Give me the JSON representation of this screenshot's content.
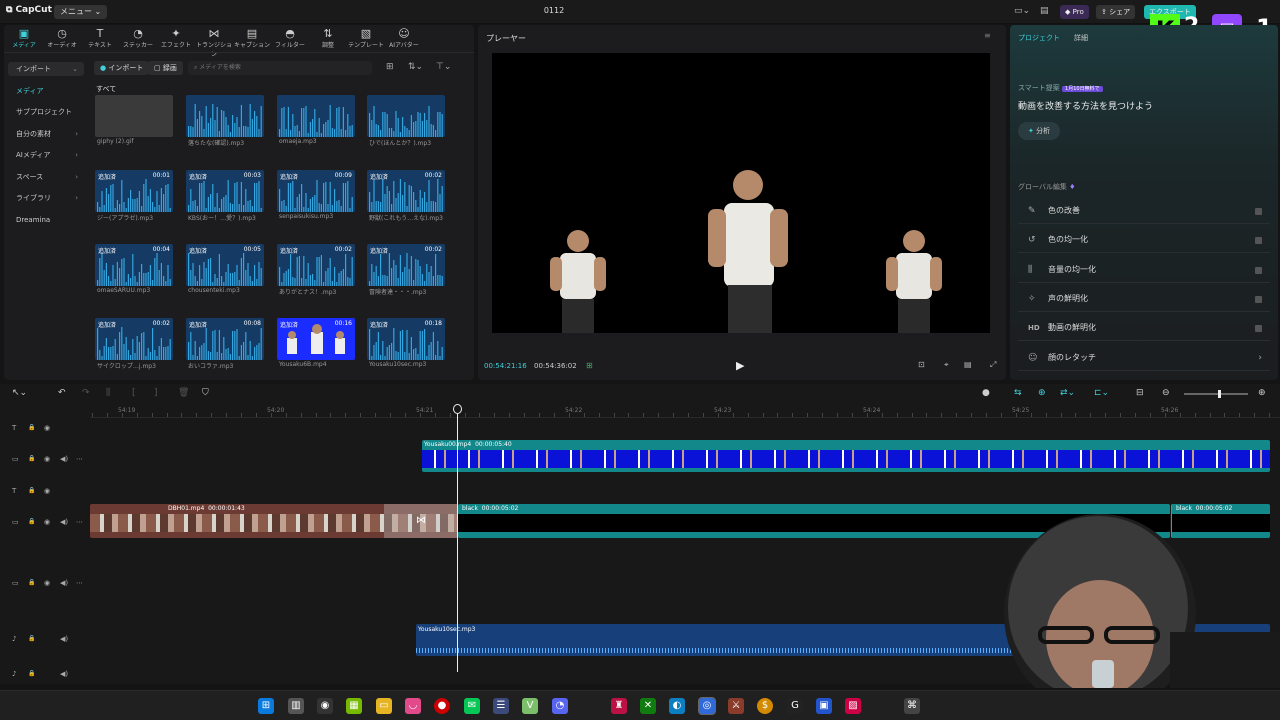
{
  "titlebar": {
    "app_name": "CapCut",
    "menu_label": "メニュー",
    "title": "0112",
    "pro_label": "Pro",
    "share_label": "シェア",
    "export_label": "エクスポート",
    "overlay_score": "2",
    "overlay_right": "1"
  },
  "media_tabs": [
    {
      "label": "メディア",
      "icon": "media-icon"
    },
    {
      "label": "オーディオ",
      "icon": "audio-icon"
    },
    {
      "label": "テキスト",
      "icon": "text-icon"
    },
    {
      "label": "ステッカー",
      "icon": "sticker-icon"
    },
    {
      "label": "エフェクト",
      "icon": "effect-icon"
    },
    {
      "label": "トランジション",
      "icon": "transition-icon"
    },
    {
      "label": "キャプション",
      "icon": "caption-icon"
    },
    {
      "label": "フィルター",
      "icon": "filter-icon"
    },
    {
      "label": "調整",
      "icon": "adjust-icon"
    },
    {
      "label": "テンプレート",
      "icon": "template-icon"
    },
    {
      "label": "AIアバター",
      "icon": "avatar-icon"
    }
  ],
  "sidebar": [
    {
      "label": "インポート",
      "chev": "⌄"
    },
    {
      "label": "メディア",
      "chev": ""
    },
    {
      "label": "サブプロジェクト",
      "chev": ""
    },
    {
      "label": "自分の素材",
      "chev": "›"
    },
    {
      "label": "AIメディア",
      "chev": "›"
    },
    {
      "label": "スペース",
      "chev": "›"
    },
    {
      "label": "ライブラリ",
      "chev": "›"
    },
    {
      "label": "Dreamina",
      "chev": ""
    }
  ],
  "media_toolbar": {
    "import_label": "インポート",
    "record_label": "録画",
    "search_placeholder": "メディアを検索",
    "all_label": "すべて"
  },
  "media_items": [
    {
      "name": "giphy (2).gif",
      "tag": "",
      "dur": ""
    },
    {
      "name": "落ちたな(確認).mp3",
      "tag": "",
      "dur": ""
    },
    {
      "name": "omaeja.mp3",
      "tag": "",
      "dur": ""
    },
    {
      "name": "ひで(ほんとか？).mp3",
      "tag": "",
      "dur": ""
    },
    {
      "name": "ジー(アプラゼ).mp3",
      "tag": "追加済",
      "dur": "00:01"
    },
    {
      "name": "KBS(おー！…愛？).mp3",
      "tag": "追加済",
      "dur": "00:03"
    },
    {
      "name": "senpaisukisu.mp3",
      "tag": "追加済",
      "dur": "00:09"
    },
    {
      "name": "野獣(これもう…えな).mp3",
      "tag": "追加済",
      "dur": "00:02"
    },
    {
      "name": "omaeSARUU.mp3",
      "tag": "追加済",
      "dur": "00:04"
    },
    {
      "name": "chousenteki.mp3",
      "tag": "追加済",
      "dur": "00:05"
    },
    {
      "name": "ありがとナス！.mp3",
      "tag": "追加済",
      "dur": "00:02"
    },
    {
      "name": "冒険者達・・・.mp3",
      "tag": "追加済",
      "dur": "00:02"
    },
    {
      "name": "サイクロップ…j.mp3",
      "tag": "追加済",
      "dur": "00:02"
    },
    {
      "name": "おいコラァ.mp3",
      "tag": "追加済",
      "dur": "00:08"
    },
    {
      "name": "Yousaku6B.mp4",
      "tag": "追加済",
      "dur": "00:16"
    },
    {
      "name": "Yousaku10sec.mp3",
      "tag": "追加済",
      "dur": "00:18"
    }
  ],
  "player": {
    "title": "プレーヤー",
    "current_time": "00:54:21:16",
    "total_time": "00:54:36:02"
  },
  "props": {
    "tab_project": "プロジェクト",
    "tab_detail": "詳細",
    "smart_title": "スマート提案",
    "smart_badge": "1月10日無料で",
    "smart_heading": "動画を改善する方法を見つけよう",
    "analyze_label": "分析",
    "global_title": "グローバル編集",
    "items": [
      {
        "label": "色の改善",
        "icon": "color-wand-icon"
      },
      {
        "label": "色の均一化",
        "icon": "color-match-icon"
      },
      {
        "label": "音量の均一化",
        "icon": "volume-eq-icon"
      },
      {
        "label": "声の鮮明化",
        "icon": "voice-icon"
      },
      {
        "label": "動画の鮮明化",
        "icon": "hd-icon"
      },
      {
        "label": "顔のレタッチ",
        "icon": "face-icon"
      }
    ],
    "hd_text": "HD"
  },
  "timeline": {
    "ruler": [
      "54:19",
      "54:20",
      "54:21",
      "54:22",
      "54:23",
      "54:24",
      "54:25",
      "54:26"
    ],
    "clip_video_top": {
      "name": "Yousaku00.mp4",
      "dur": "00:00:05:40"
    },
    "clip_main": {
      "name": "DBH01.mp4",
      "dur": "00:00:01:43"
    },
    "clip_black1": {
      "name": "black",
      "dur": "00:00:05:02"
    },
    "clip_black2": {
      "name": "black",
      "dur": "00:00:05:02"
    },
    "clip_audio": {
      "name": "Yousaku10sec.mp3"
    }
  },
  "colors": {
    "accent": "#3fd0d8",
    "teal_clip": "#13888a",
    "audio_clip": "#1b4a8a",
    "thumb_blue": "#1f3a66"
  }
}
